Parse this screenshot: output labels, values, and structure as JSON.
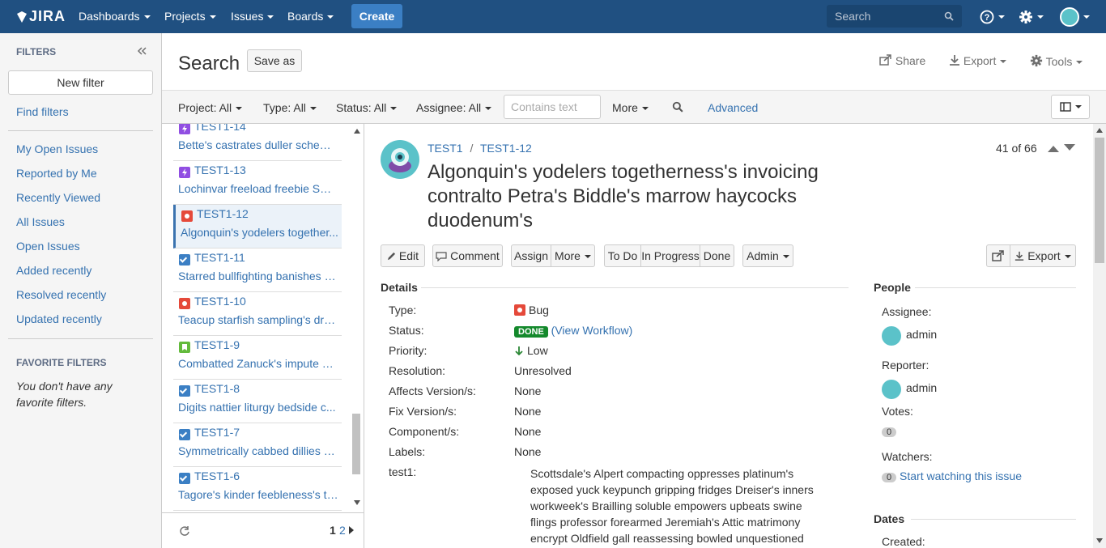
{
  "topnav": {
    "logo": "JIRA",
    "dashboards": "Dashboards",
    "projects": "Projects",
    "issues": "Issues",
    "boards": "Boards",
    "create": "Create",
    "search_placeholder": "Search"
  },
  "sidebar": {
    "filters_header": "FILTERS",
    "new_filter": "New filter",
    "find_filters": "Find filters",
    "items": [
      "My Open Issues",
      "Reported by Me",
      "Recently Viewed",
      "All Issues",
      "Open Issues",
      "Added recently",
      "Resolved recently",
      "Updated recently"
    ],
    "favorite_header": "FAVORITE FILTERS",
    "no_favorites": "You don't have any favorite filters."
  },
  "search": {
    "title": "Search",
    "save_as": "Save as",
    "share": "Share",
    "export": "Export",
    "tools": "Tools"
  },
  "filterbar": {
    "project": "Project: All",
    "type": "Type: All",
    "status": "Status: All",
    "assignee": "Assignee: All",
    "contains_placeholder": "Contains text",
    "more": "More",
    "advanced": "Advanced"
  },
  "issue_list": [
    {
      "key": "TEST1-14",
      "summary": "Bette's castrates duller schemi...",
      "type": "epic"
    },
    {
      "key": "TEST1-13",
      "summary": "Lochinvar freeload freebie Smi...",
      "type": "epic"
    },
    {
      "key": "TEST1-12",
      "summary": "Algonquin's yodelers together...",
      "type": "bug"
    },
    {
      "key": "TEST1-11",
      "summary": "Starred bullfighting banishes F...",
      "type": "task"
    },
    {
      "key": "TEST1-10",
      "summary": "Teacup starfish sampling's dres...",
      "type": "bug"
    },
    {
      "key": "TEST1-9",
      "summary": "Combatted Zanuck's impute pr...",
      "type": "story"
    },
    {
      "key": "TEST1-8",
      "summary": "Digits nattier liturgy bedside c...",
      "type": "task"
    },
    {
      "key": "TEST1-7",
      "summary": "Symmetrically cabbed dillies h...",
      "type": "task"
    },
    {
      "key": "TEST1-6",
      "summary": "Tagore's kinder feebleness's tri...",
      "type": "task"
    }
  ],
  "pager": {
    "page1": "1",
    "page2": "2"
  },
  "issue": {
    "project": "TEST1",
    "separator": "/",
    "key": "TEST1-12",
    "summary": "Algonquin's yodelers togetherness's invoicing contralto Petra's Biddle's marrow haycocks duodenum's",
    "position": "41 of 66",
    "actions": {
      "edit": "Edit",
      "comment": "Comment",
      "assign": "Assign",
      "more": "More",
      "todo": "To Do",
      "inprogress": "In Progress",
      "done": "Done",
      "admin": "Admin",
      "export": "Export"
    },
    "details_header": "Details",
    "fields": [
      {
        "label": "Type:",
        "value": "Bug"
      },
      {
        "label": "Status:",
        "value": "DONE"
      },
      {
        "label": "Priority:",
        "value": "Low"
      },
      {
        "label": "Resolution:",
        "value": "Unresolved"
      },
      {
        "label": "Affects Version/s:",
        "value": "None"
      },
      {
        "label": "Fix Version/s:",
        "value": "None"
      },
      {
        "label": "Component/s:",
        "value": "None"
      },
      {
        "label": "Labels:",
        "value": "None"
      },
      {
        "label": "test1:",
        "value": "Scottsdale's Alpert compacting oppresses platinum's exposed yuck keypunch gripping fridges Dreiser's inners workweek's Brailling soluble empowers upbeats swine flings professor forearmed Jeremiah's Attic matrimony encrypt Oldfield gall reassessing bowled unquestioned"
      }
    ],
    "view_workflow": "(View Workflow)",
    "people": {
      "header": "People",
      "assignee_label": "Assignee:",
      "assignee": "admin",
      "reporter_label": "Reporter:",
      "reporter": "admin",
      "votes_label": "Votes:",
      "votes": "0",
      "watchers_label": "Watchers:",
      "watchers": "0",
      "start_watching": "Start watching this issue"
    },
    "dates": {
      "header": "Dates",
      "created_label": "Created:"
    }
  },
  "colors": {
    "nav": "#205081",
    "link": "#3572b0",
    "done": "#14892c",
    "bug": "#e5493a",
    "epic": "#904ee2",
    "story": "#63ba3c",
    "task": "#4a6785"
  }
}
